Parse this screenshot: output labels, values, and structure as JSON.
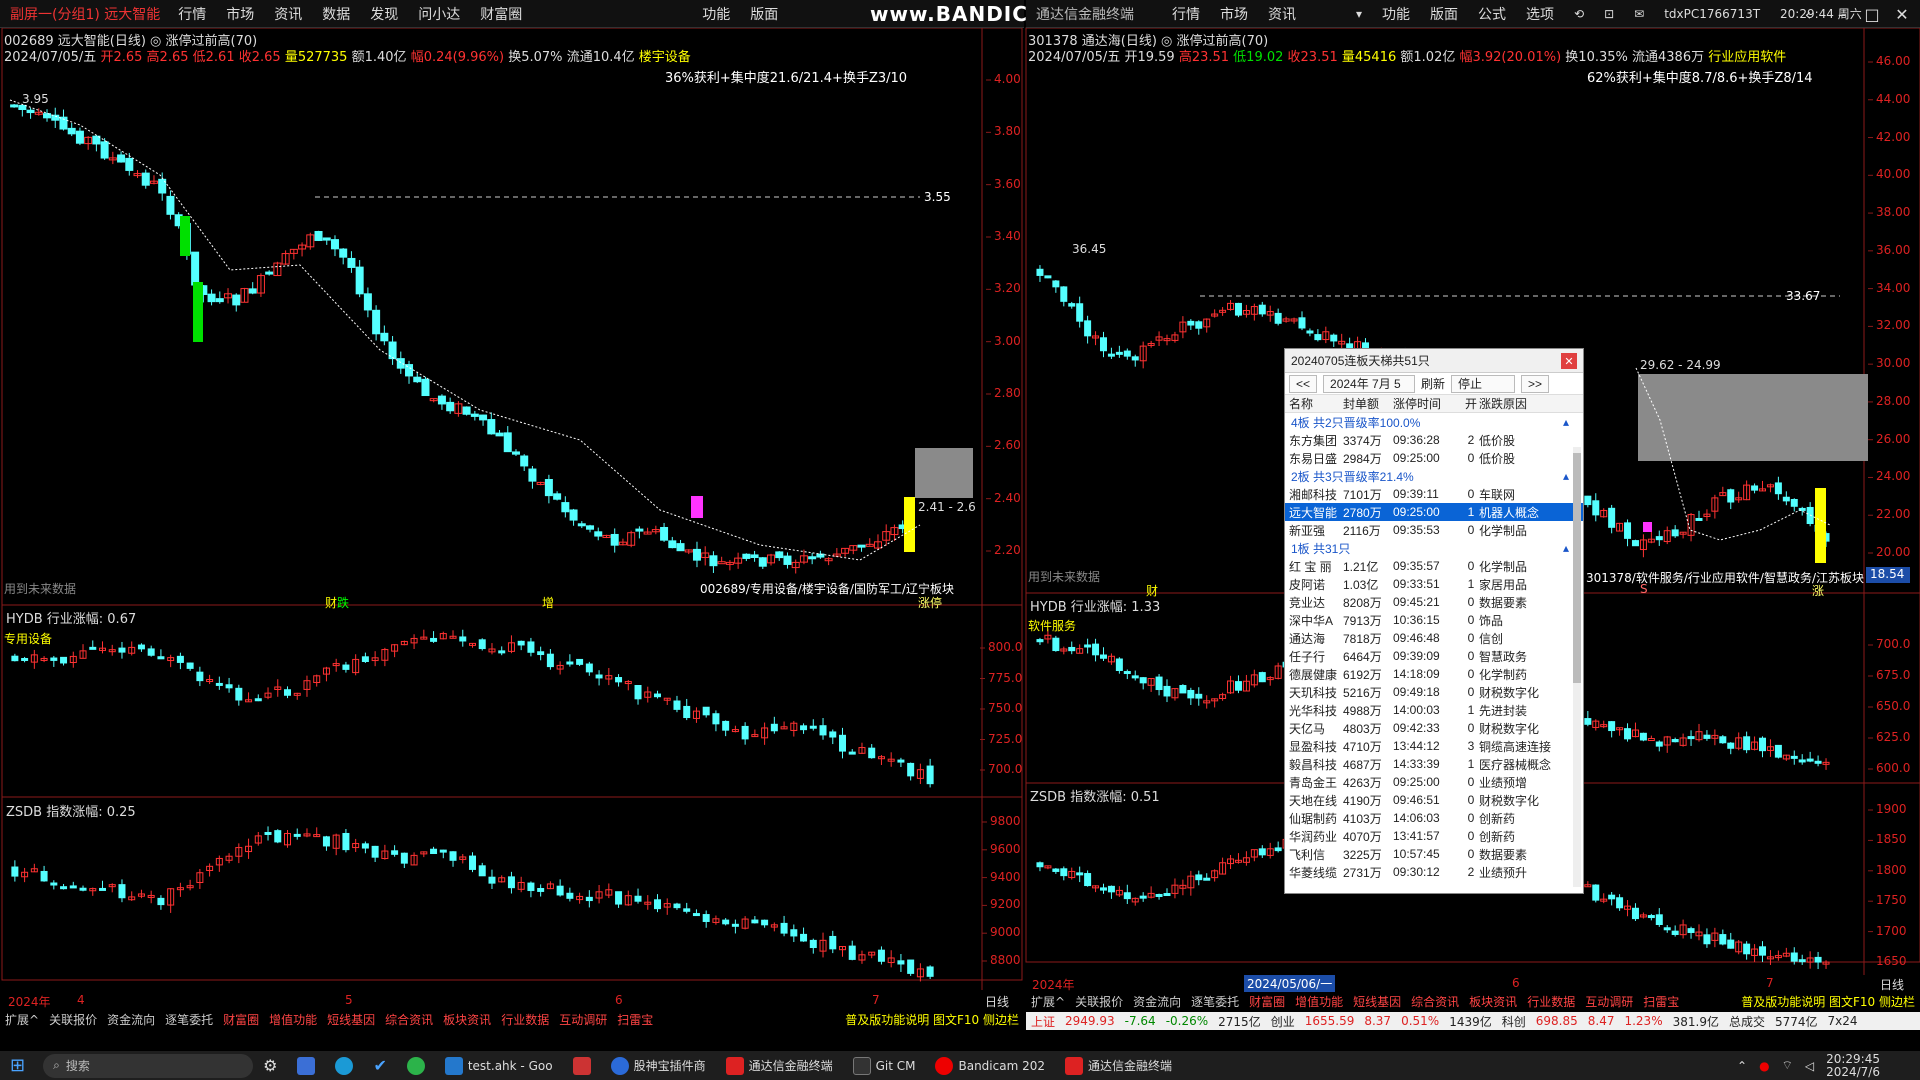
{
  "left_window": {
    "menu": {
      "brand": "副屏一(分组1) 远大智能",
      "items": [
        "行情",
        "市场",
        "资讯",
        "数据",
        "发现",
        "问小达",
        "财富圈"
      ],
      "extra": [
        "功能",
        "版面"
      ]
    },
    "watermark": "www.BANDICAM.com",
    "title": "002689 远大智能(日线) ◎ 涨停过前高(70)",
    "info": {
      "date": "2024/07/05/五",
      "open": "开2.65",
      "high": "高2.65",
      "low": "低2.61",
      "close": "收2.65",
      "vol": "量527735",
      "amount": "额1.40亿",
      "change": "幅0.24(9.96%)",
      "turnover": "换5.07%",
      "float": "流通10.4亿",
      "sector": "楼宇设备"
    },
    "annotation": "36%获利+集中度21.6/21.4+换手Z3/10",
    "high_label": "3.95",
    "dash_label": "3.55",
    "box_label": "2.41 - 2.6",
    "future_label": "用到未来数据",
    "tags": {
      "cai": "财",
      "die": "跌",
      "zeng": "增",
      "zhangting": "涨停"
    },
    "sector_label": "002689/专用设备/楼宇设备/国防军工/辽宁板块",
    "price_axis": [
      "4.00",
      "3.80",
      "3.60",
      "3.40",
      "3.20",
      "3.00",
      "2.80",
      "2.60",
      "2.40",
      "2.20"
    ],
    "hydb": "HYDB 行业涨幅: 0.67",
    "hydb_name": "专用设备",
    "hydb_axis": [
      "800.0",
      "775.0",
      "750.0",
      "725.0",
      "700.0"
    ],
    "zsdb": "ZSDB 指数涨幅: 0.25",
    "zsdb_axis": [
      "9800",
      "9600",
      "9400",
      "9200",
      "9000",
      "8800"
    ],
    "x_axis": {
      "year": "2024年",
      "m4": "4",
      "m5": "5",
      "m6": "6",
      "m7": "7",
      "day": "日线"
    },
    "bottom_tabs": [
      "扩展^",
      "关联报价",
      "资金流向",
      "逐笔委托",
      "财富圈",
      "增值功能",
      "短线基因",
      "综合资讯",
      "板块资讯",
      "行业数据",
      "互动调研",
      "扫雷宝"
    ],
    "bottom_right": "普及版功能说明 图文F10 侧边栏"
  },
  "right_window": {
    "menu": {
      "brand": "通达信金融终端",
      "items": [
        "行情",
        "市场",
        "资讯"
      ],
      "extra": [
        "功能",
        "版面",
        "公式",
        "选项"
      ],
      "user": "tdxPC1766713T",
      "clock": "20:29:44 周六"
    },
    "title": "301378 通达海(日线) ◎ 涨停过前高(70)",
    "info": {
      "date": "2024/07/05/五",
      "open": "开19.59",
      "high": "高23.51",
      "low": "低19.02",
      "close": "收23.51",
      "vol": "量45416",
      "amount": "额1.02亿",
      "change": "幅3.92(20.01%)",
      "turnover": "换10.35%",
      "float": "流通4386万",
      "sector": "行业应用软件"
    },
    "annotation": "62%获利+集中度8.7/8.6+换手Z8/14",
    "high_label": "36.45",
    "dash_label": "33.67",
    "box_label": "29.62 - 24.99",
    "last_price": "18.54",
    "future_label": "用到未来数据",
    "tags": {
      "cai": "财",
      "s": "S",
      "zhang": "涨"
    },
    "sector_label": "301378/软件服务/行业应用软件/智慧政务/江苏板块",
    "price_axis": [
      "46.00",
      "44.00",
      "42.00",
      "40.00",
      "38.00",
      "36.00",
      "34.00",
      "32.00",
      "30.00",
      "28.00",
      "26.00",
      "24.00",
      "22.00",
      "20.00"
    ],
    "hydb": "HYDB 行业涨幅: 1.33",
    "hydb_name": "软件服务",
    "hydb_axis": [
      "700.0",
      "675.0",
      "650.0",
      "625.0",
      "600.0"
    ],
    "zsdb": "ZSDB 指数涨幅: 0.51",
    "zsdb_axis": [
      "1900",
      "1850",
      "1800",
      "1750",
      "1700",
      "1650"
    ],
    "x_axis": {
      "year": "2024年",
      "cursor": "2024/05/06/一",
      "m6": "6",
      "m7": "7",
      "day": "日线"
    },
    "bottom_tabs": [
      "扩展^",
      "关联报价",
      "资金流向",
      "逐笔委托",
      "财富圈",
      "增值功能",
      "短线基因",
      "综合资讯",
      "板块资讯",
      "行业数据",
      "互动调研",
      "扫雷宝"
    ],
    "bottom_right": "普及版功能说明 图文F10 侧边栏"
  },
  "dialog": {
    "title": "20240705连板天梯共51只",
    "toolbar": {
      "prev": "<<",
      "date": "2024年 7月 5",
      "refresh": "刷新",
      "stop": "停止",
      "next": ">>"
    },
    "columns": [
      "名称",
      "封单额",
      "涨停时间",
      "开",
      "涨跌原因"
    ],
    "groups": [
      {
        "header": "4板 共2只晋级率100.0%",
        "rows": [
          [
            "东方集团",
            "3374万",
            "09:36:28",
            "2",
            "低价股"
          ],
          [
            "东易日盛",
            "2984万",
            "09:25:00",
            "0",
            "低价股"
          ]
        ]
      },
      {
        "header": "2板 共3只晋级率21.4%",
        "rows": [
          [
            "湘邮科技",
            "7101万",
            "09:39:11",
            "0",
            "车联网"
          ],
          [
            "远大智能",
            "2780万",
            "09:25:00",
            "1",
            "机器人概念"
          ],
          [
            "新亚强",
            "2116万",
            "09:35:53",
            "0",
            "化学制品"
          ]
        ]
      },
      {
        "header": "1板 共31只",
        "rows": [
          [
            "红 宝 丽",
            "1.21亿",
            "09:35:57",
            "0",
            "化学制品"
          ],
          [
            "皮阿诺",
            "1.03亿",
            "09:33:51",
            "1",
            "家居用品"
          ],
          [
            "竞业达",
            "8208万",
            "09:45:21",
            "0",
            "数据要素"
          ],
          [
            "深中华A",
            "7913万",
            "10:36:15",
            "0",
            "饰品"
          ],
          [
            "通达海",
            "7818万",
            "09:46:48",
            "0",
            "信创"
          ],
          [
            "任子行",
            "6464万",
            "09:39:09",
            "0",
            "智慧政务"
          ],
          [
            "德展健康",
            "6192万",
            "14:18:09",
            "0",
            "化学制药"
          ],
          [
            "天玑科技",
            "5216万",
            "09:49:18",
            "0",
            "财税数字化"
          ],
          [
            "光华科技",
            "4988万",
            "14:00:03",
            "1",
            "先进封装"
          ],
          [
            "天亿马",
            "4803万",
            "09:42:33",
            "0",
            "财税数字化"
          ],
          [
            "显盈科技",
            "4710万",
            "13:44:12",
            "3",
            "铜缆高速连接"
          ],
          [
            "毅昌科技",
            "4687万",
            "14:33:39",
            "1",
            "医疗器械概念"
          ],
          [
            "青岛金王",
            "4263万",
            "09:25:00",
            "0",
            "业绩预增"
          ],
          [
            "天地在线",
            "4190万",
            "09:46:51",
            "0",
            "财税数字化"
          ],
          [
            "仙琚制药",
            "4103万",
            "14:06:03",
            "0",
            "创新药"
          ],
          [
            "华润药业",
            "4070万",
            "13:41:57",
            "0",
            "创新药"
          ],
          [
            "飞利信",
            "3225万",
            "10:57:45",
            "0",
            "数据要素"
          ],
          [
            "华菱线缆",
            "2731万",
            "09:30:12",
            "2",
            "业绩预升"
          ]
        ]
      }
    ]
  },
  "statusbar": {
    "sh": "上证",
    "sh_val": "2949.93",
    "sh_chg": "-7.64",
    "sh_pct": "-0.26%",
    "sh_amt": "2715亿",
    "cy": "创业",
    "cy_val": "1655.59",
    "cy_chg": "8.37",
    "cy_pct": "0.51%",
    "cy_amt": "1439亿",
    "kc": "科创",
    "kc_val": "698.85",
    "kc_chg": "8.47",
    "kc_pct": "1.23%",
    "kc_amt": "381.9亿",
    "total_lbl": "总成交",
    "total": "5774亿",
    "mode": "7x24"
  },
  "taskbar": {
    "search": "搜索",
    "apps": [
      "test.ahk - Goo",
      "股神宝插件商",
      "通达信金融终端",
      "Git CM",
      "Bandicam 202",
      "通达信金融终端"
    ],
    "time": "20:29:45",
    "date": "2024/7/6"
  },
  "colors": {
    "up": "#ff3232",
    "down": "#54ffff",
    "axis": "#d22020",
    "ma": "#ffffff",
    "yellow": "#ffff00",
    "magenta": "#ff33ff",
    "green": "#00e000",
    "grey_box": "#8a8a8a"
  }
}
